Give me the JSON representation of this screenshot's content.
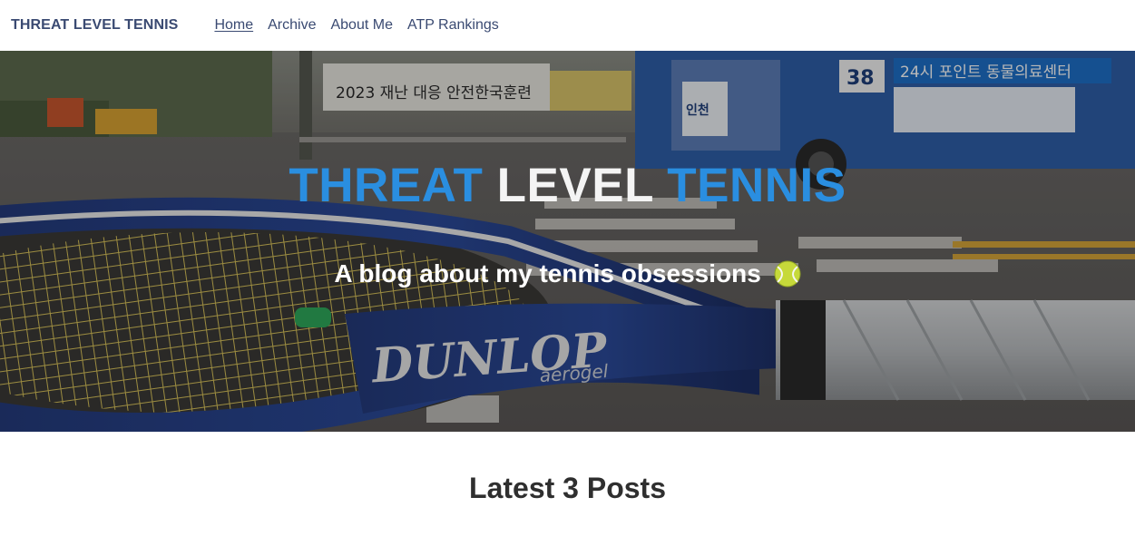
{
  "nav": {
    "brand": "THREAT LEVEL TENNIS",
    "links": [
      {
        "label": "Home",
        "active": true
      },
      {
        "label": "Archive",
        "active": false
      },
      {
        "label": "About Me",
        "active": false
      },
      {
        "label": "ATP Rankings",
        "active": false
      }
    ]
  },
  "hero": {
    "title_word_1": "THREAT",
    "title_word_2": "LEVEL",
    "title_word_3": "TENNIS",
    "subtitle": "A blog about my tennis obsessions",
    "subtitle_icon": "tennis-ball-icon",
    "background_image_text": {
      "bus_number": "38",
      "bus_sign": "24시 포인트 동물의료센터",
      "bus_destination": "인천",
      "banner_text": "2023 재난 대응 안전한국훈련",
      "racket_brand": "DUNLOP",
      "racket_model": "aerogel"
    }
  },
  "latest": {
    "heading": "Latest 3 Posts"
  },
  "colors": {
    "nav_text": "#3a4a72",
    "title_accent": "#2a8ee0",
    "title_white": "#f4f4f4",
    "heading_text": "#2f2f2f"
  }
}
